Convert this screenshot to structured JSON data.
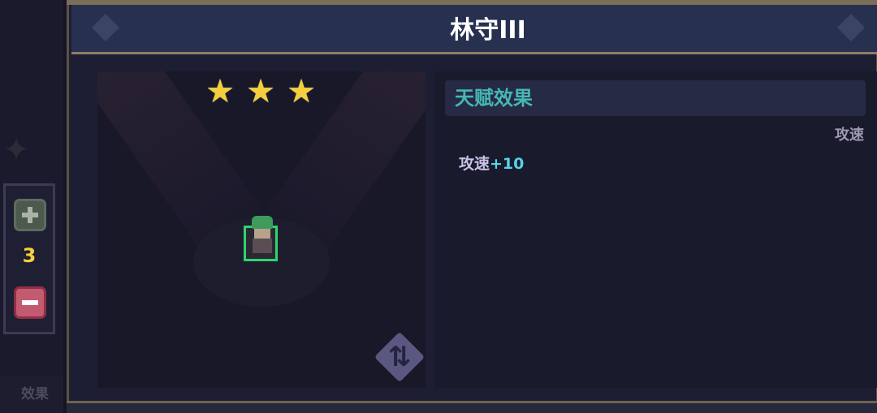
{
  "title": "林守III",
  "stars": {
    "count": 3,
    "glyph": "★"
  },
  "counter": {
    "value": "3"
  },
  "talent": {
    "header": "天赋效果",
    "tag": "攻速",
    "effect_stat": "攻速",
    "effect_value": "+10"
  },
  "left_bottom_label": "效果",
  "swap_glyph": "⇅",
  "icons": {
    "plus": "plus-icon",
    "minus": "minus-icon",
    "swap": "swap-icon",
    "star": "star-icon"
  },
  "colors": {
    "title": "#ffffff",
    "talent_header": "#45b8b4",
    "effect_value": "#56d3e6",
    "counter_value": "#f6cf3d",
    "star": "#f4cf3b",
    "minus_button": "#c45a70",
    "plus_button": "#4b5a4d",
    "hero_frame": "#2cd66c"
  }
}
